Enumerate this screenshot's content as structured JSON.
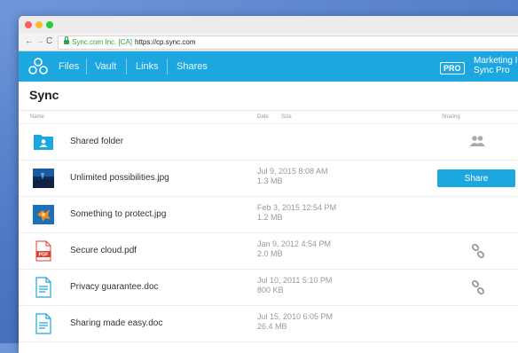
{
  "browser": {
    "secure_label": "Sync.com Inc. [CA]",
    "url": "https://cp.sync.com",
    "back_glyph": "←",
    "forward_glyph": "→",
    "reload_glyph": "C"
  },
  "nav": {
    "files": "Files",
    "vault": "Vault",
    "links": "Links",
    "shares": "Shares",
    "pro_badge": "PRO",
    "account_line1": "Marketing I",
    "account_line2": "Sync Pro",
    "accent": "#1da7e0"
  },
  "page": {
    "title": "Sync",
    "columns": {
      "name": "Name",
      "date": "Date",
      "size": "Size",
      "sharing": "Sharing"
    }
  },
  "files": [
    {
      "icon": "folder-shared-icon",
      "name": "Shared folder",
      "date": "",
      "size": "",
      "sharing": "people-icon"
    },
    {
      "icon": "image-thumbnail-icon",
      "name": "Unlimited possibilities.jpg",
      "date": "Jul 9, 2015  8:08 AM",
      "size": "1.3 MB",
      "sharing": "share-button",
      "share_label": "Share"
    },
    {
      "icon": "image-thumbnail-icon",
      "name": "Something to protect.jpg",
      "date": "Feb 3, 2015  12:54 PM",
      "size": "1.2 MB",
      "sharing": ""
    },
    {
      "icon": "pdf-file-icon",
      "name": "Secure cloud.pdf",
      "date": "Jan 9, 2012  4:54 PM",
      "size": "2.0 MB",
      "sharing": "link-icon",
      "pdf_label": "PDF"
    },
    {
      "icon": "doc-file-icon",
      "name": "Privacy guarantee.doc",
      "date": "Jul 10, 2011  5:10 PM",
      "size": "800 KB",
      "sharing": "link-icon"
    },
    {
      "icon": "doc-file-icon",
      "name": "Sharing made easy.doc",
      "date": "Jul 15, 2010  6:05 PM",
      "size": "26.4 MB",
      "sharing": ""
    }
  ]
}
